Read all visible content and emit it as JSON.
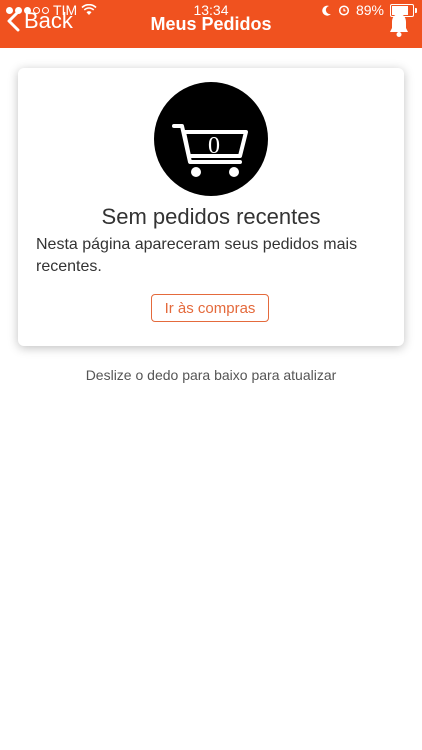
{
  "status_bar": {
    "carrier": "TIM",
    "time": "13:34",
    "battery": "89%",
    "battery_level": 0.89
  },
  "nav": {
    "back_label": "Back",
    "title": "Meus Pedidos"
  },
  "card": {
    "cart_count": "0",
    "title": "Sem pedidos recentes",
    "text": "Nesta página apareceram seus pedidos mais recentes.",
    "button_label": "Ir às compras"
  },
  "hint": "Deslize o dedo para baixo para atualizar",
  "colors": {
    "accent": "#f0521f",
    "button_text": "#e46a3c"
  }
}
